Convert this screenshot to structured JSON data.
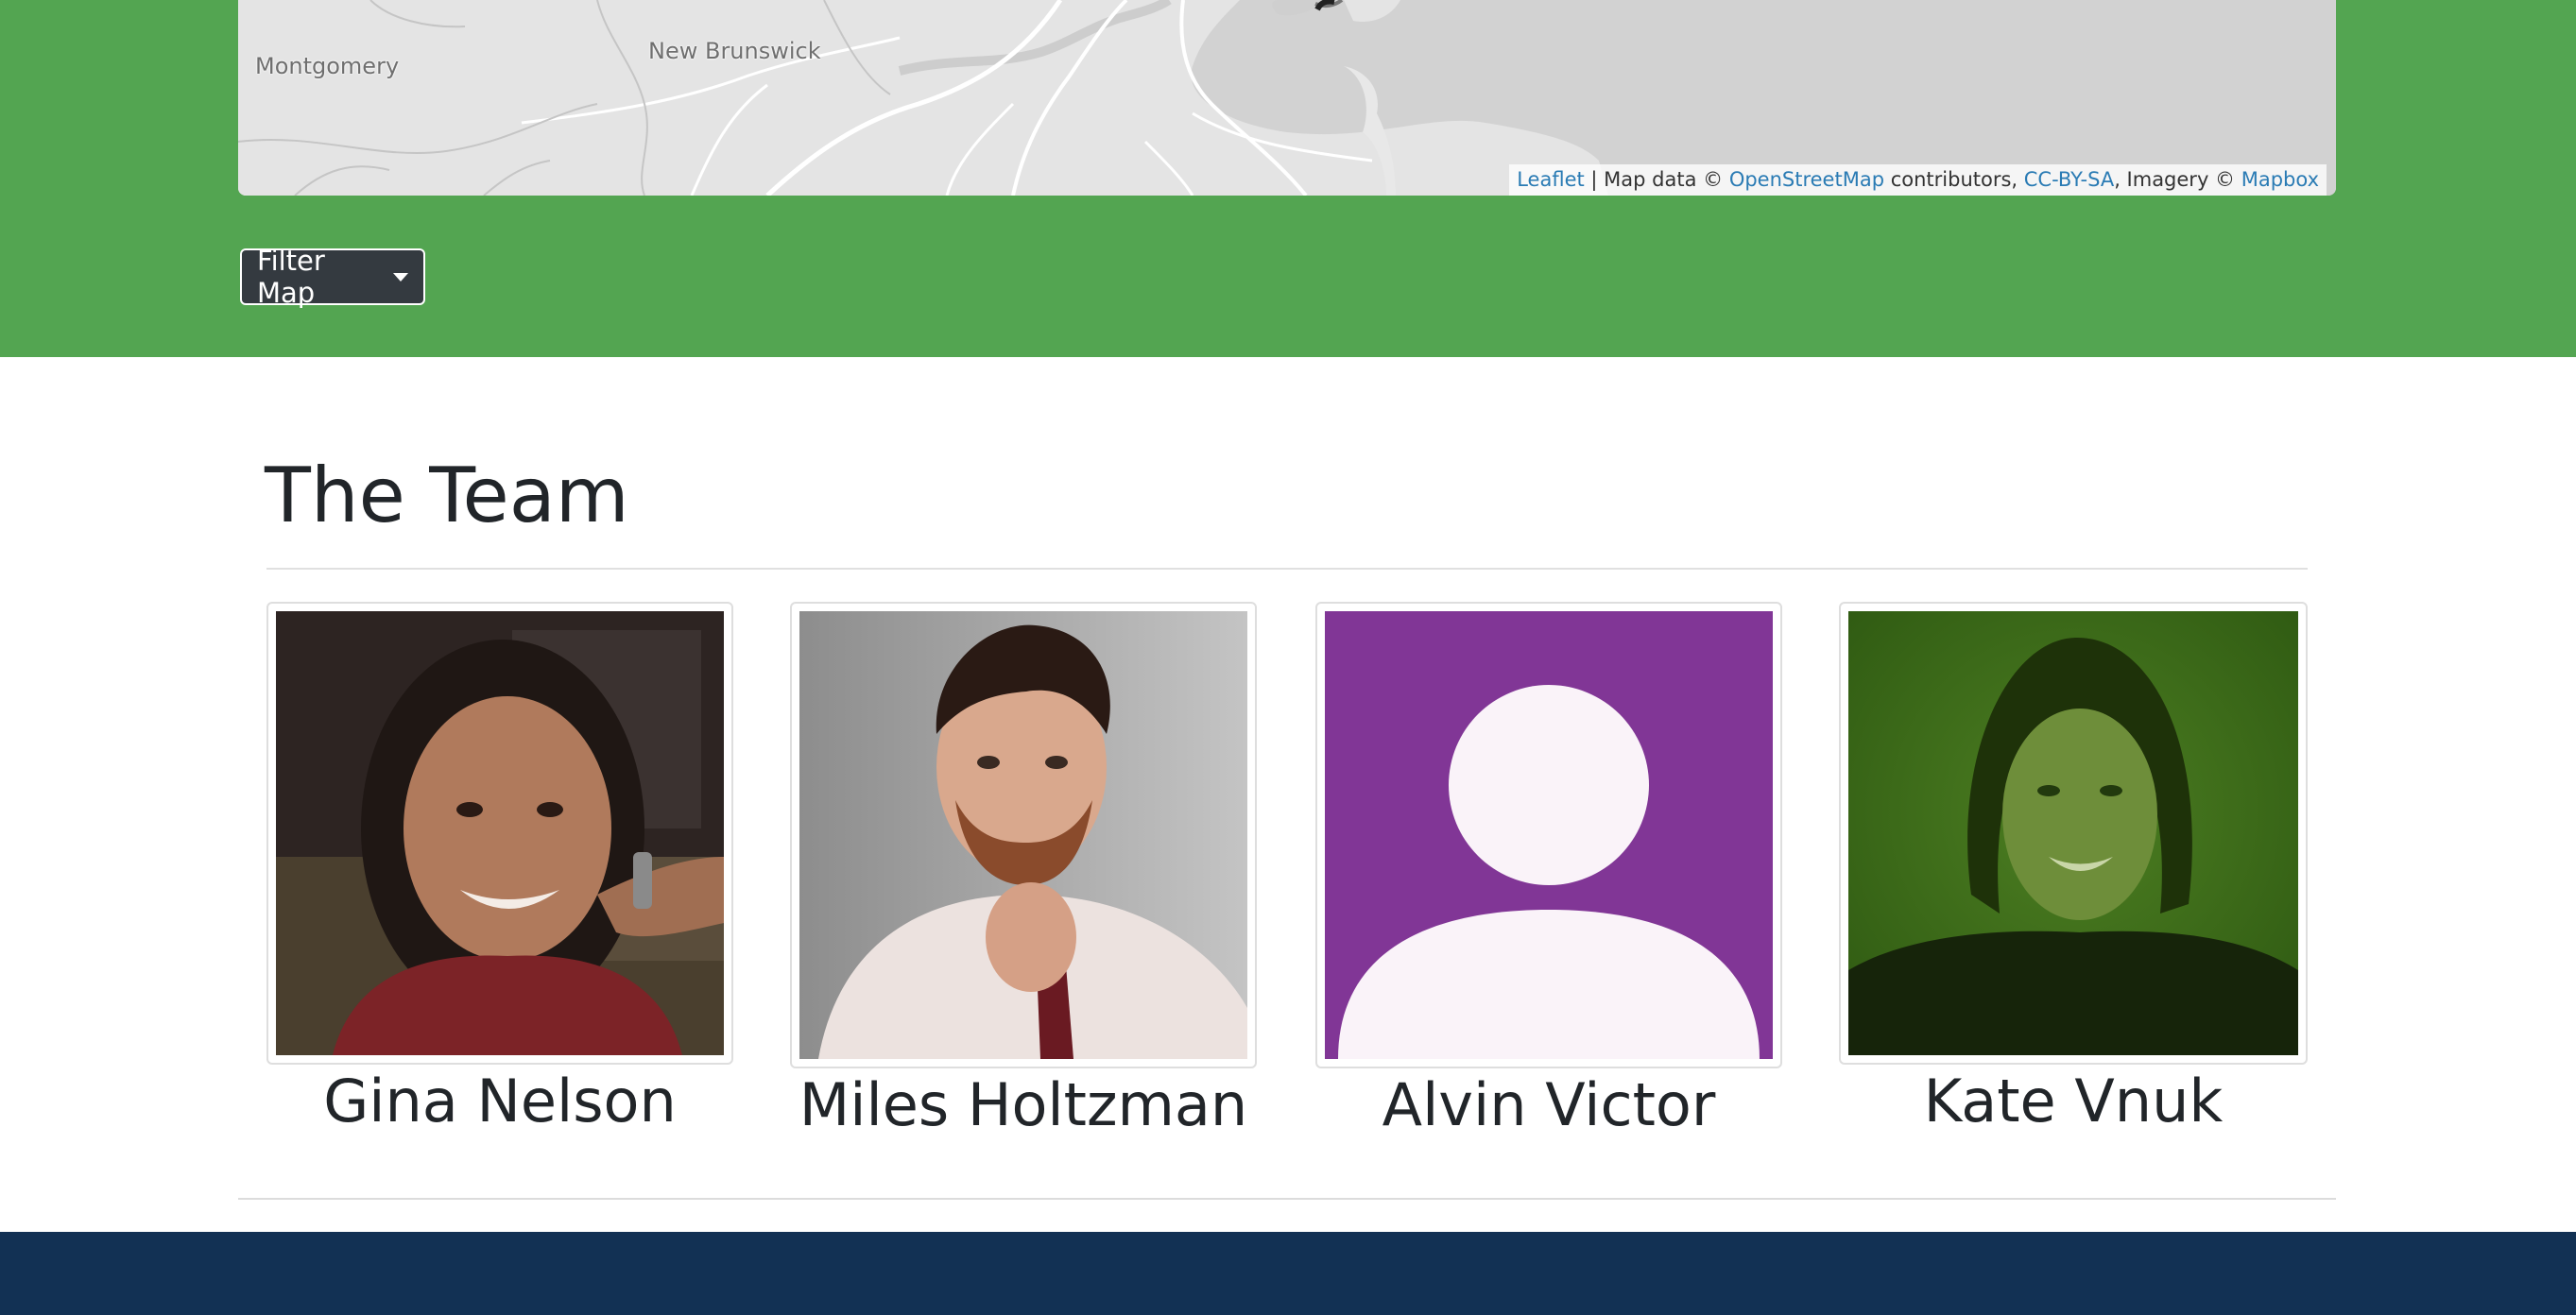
{
  "map": {
    "labels": {
      "montgomery": "Montgomery",
      "new_brunswick": "New Brunswick"
    },
    "attribution": {
      "leaflet": "Leaflet",
      "sep1": " | Map data © ",
      "osm": "OpenStreetMap",
      "sep2": " contributors, ",
      "license": "CC-BY-SA",
      "sep3": ", Imagery © ",
      "mapbox": "Mapbox"
    }
  },
  "filter": {
    "label": "Filter Map"
  },
  "team": {
    "title": "The Team",
    "members": [
      {
        "name": "Gina Nelson"
      },
      {
        "name": "Miles Holtzman"
      },
      {
        "name": "Alvin Victor"
      },
      {
        "name": "Kate Vnuk"
      }
    ]
  },
  "colors": {
    "band_green": "#53a551",
    "footer_navy": "#123154",
    "placeholder_purple": "#813696",
    "link_blue": "#2a7bb4"
  }
}
